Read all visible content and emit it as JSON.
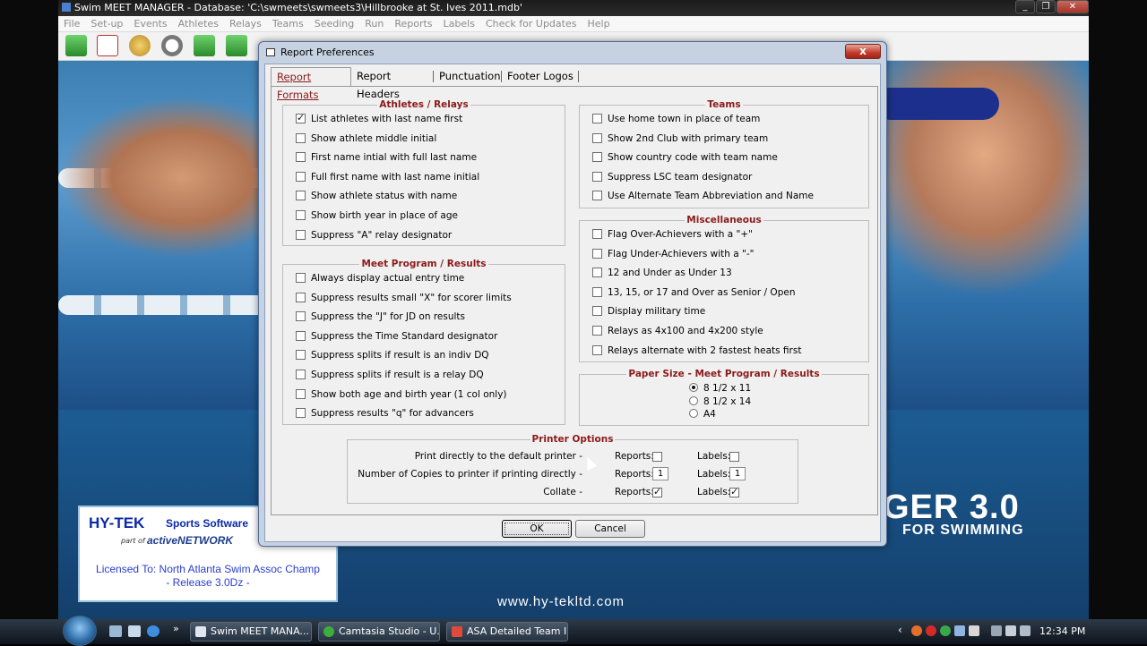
{
  "app": {
    "title": "Swim MEET MANAGER - Database: 'C:\\swmeets\\swmeets3\\Hillbrooke at St. Ives 2011.mdb'",
    "menu": [
      "File",
      "Set-up",
      "Events",
      "Athletes",
      "Relays",
      "Teams",
      "Seeding",
      "Run",
      "Reports",
      "Labels",
      "Check for Updates",
      "Help"
    ]
  },
  "branding": {
    "product": "GER 3.0",
    "subtitle": "FOR SWIMMING",
    "url": "www.hy-tekltd.com",
    "logo_main": "HY-TEK",
    "logo_sub": "Sports Software",
    "part_of": "part of",
    "active_network": "activeNETWORK",
    "license_line1": "Licensed To:  North Atlanta Swim Assoc Champ",
    "license_line2": "- Release 3.0Dz -"
  },
  "dialog": {
    "title": "Report Preferences",
    "close_label": "x",
    "tabs": [
      {
        "label": "Report Formats",
        "active": true
      },
      {
        "label": "Report Headers",
        "active": false
      },
      {
        "label": "Punctuation",
        "active": false
      },
      {
        "label": "Footer Logos",
        "active": false
      }
    ],
    "athletes_relays": {
      "title": "Athletes / Relays",
      "options": [
        {
          "label": "List athletes with last name first",
          "checked": true
        },
        {
          "label": "Show athlete middle initial",
          "checked": false
        },
        {
          "label": "First name intial with full last name",
          "checked": false
        },
        {
          "label": "Full first name with last name initial",
          "checked": false
        },
        {
          "label": "Show athlete status with name",
          "checked": false
        },
        {
          "label": "Show birth year in place of age",
          "checked": false
        },
        {
          "label": "Suppress \"A\" relay designator",
          "checked": false
        }
      ]
    },
    "meet_program": {
      "title": "Meet Program / Results",
      "options": [
        {
          "label": "Always display actual entry time",
          "checked": false
        },
        {
          "label": "Suppress results small \"X\" for scorer limits",
          "checked": false
        },
        {
          "label": "Suppress the \"J\" for JD on results",
          "checked": false
        },
        {
          "label": "Suppress the Time Standard designator",
          "checked": false
        },
        {
          "label": "Suppress splits if result is an indiv DQ",
          "checked": false
        },
        {
          "label": "Suppress splits if result is a relay DQ",
          "checked": false
        },
        {
          "label": "Show both age and birth year (1 col only)",
          "checked": false
        },
        {
          "label": "Suppress results \"q\" for advancers",
          "checked": false
        }
      ]
    },
    "teams": {
      "title": "Teams",
      "options": [
        {
          "label": "Use home town in place of team",
          "checked": false
        },
        {
          "label": "Show 2nd Club with primary team",
          "checked": false
        },
        {
          "label": "Show country code with team name",
          "checked": false
        },
        {
          "label": "Suppress LSC team designator",
          "checked": false
        },
        {
          "label": "Use Alternate Team Abbreviation and Name",
          "checked": false
        }
      ]
    },
    "misc": {
      "title": "Miscellaneous",
      "options": [
        {
          "label": "Flag Over-Achievers with a \"+\"",
          "checked": false
        },
        {
          "label": "Flag Under-Achievers with a \"-\"",
          "checked": false
        },
        {
          "label": "12 and Under as Under 13",
          "checked": false
        },
        {
          "label": "13, 15, or 17 and Over as Senior / Open",
          "checked": false
        },
        {
          "label": "Display military time",
          "checked": false
        },
        {
          "label": "Relays as 4x100 and 4x200 style",
          "checked": false
        },
        {
          "label": "Relays alternate with 2 fastest heats first",
          "checked": false
        }
      ]
    },
    "paper_size": {
      "title": "Paper Size - Meet Program / Results",
      "options": [
        {
          "label": "8 1/2 x 11",
          "selected": true
        },
        {
          "label": "8 1/2 x 14",
          "selected": false
        },
        {
          "label": "A4",
          "selected": false
        }
      ]
    },
    "printer": {
      "title": "Printer Options",
      "row1_label": "Print directly to the default printer -",
      "row2_label": "Number of Copies to printer if printing directly -",
      "row3_label": "Collate -",
      "reports_label": "Reports:",
      "labels_label": "Labels:",
      "print_reports": false,
      "print_labels": false,
      "copies_reports": "1",
      "copies_labels": "1",
      "collate_reports": true,
      "collate_labels": true
    },
    "ok_label": "OK",
    "cancel_label": "Cancel"
  },
  "taskbar": {
    "tasks": [
      "Swim MEET MANA...",
      "Camtasia Studio - U...",
      "ASA Detailed Team I..."
    ],
    "clock": "12:34 PM",
    "more": "»"
  }
}
